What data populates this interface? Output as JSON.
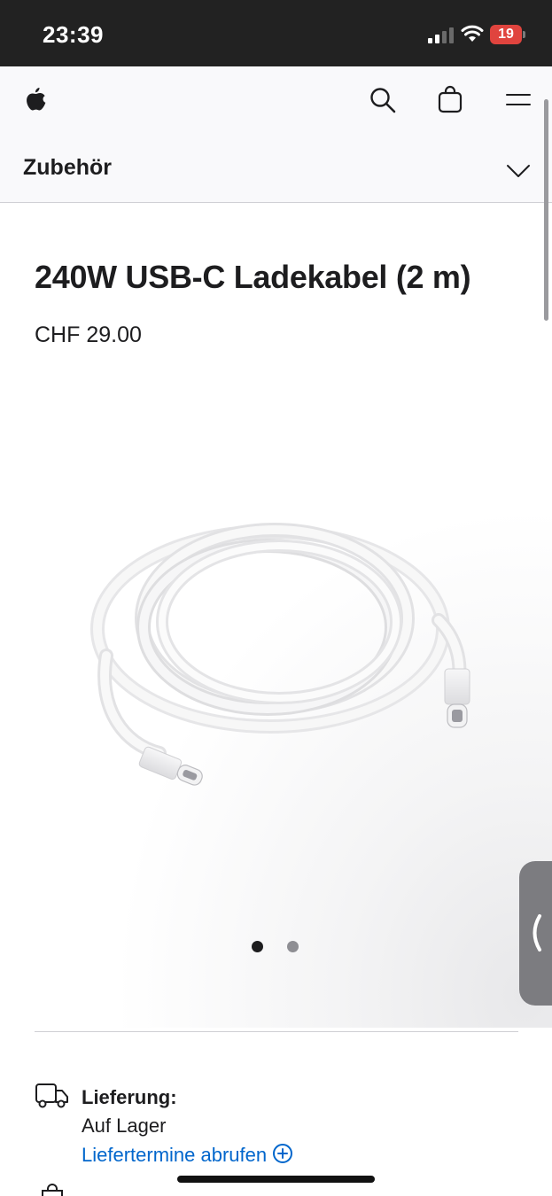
{
  "status_bar": {
    "time": "23:39",
    "battery_level": "19",
    "battery_color": "#e0443e"
  },
  "global_nav": {
    "logo_icon": "apple-logo-icon",
    "search_icon": "search-icon",
    "bag_icon": "shopping-bag-icon",
    "menu_icon": "menu-icon"
  },
  "local_nav": {
    "title": "Zubehör",
    "toggle_icon": "chevron-down-icon"
  },
  "product": {
    "title": "240W USB-C Ladekabel (2 m)",
    "price": "CHF 29.00",
    "image_icon": "usb-c-cable-image"
  },
  "gallery": {
    "pages": 2,
    "current_page": 1
  },
  "side_handle": {
    "icon": "chevron-left-icon"
  },
  "delivery": {
    "icon": "delivery-truck-icon",
    "label": "Lieferung:",
    "status": "Auf Lager",
    "link_text": "Liefertermine abrufen",
    "link_icon": "plus-circle-icon",
    "link_color": "#0066cc"
  },
  "pickup": {
    "icon": "store-bag-icon"
  },
  "colors": {
    "text": "#1d1d1f",
    "status_bar_bg": "#222222",
    "nav_bg": "#f9f9fb"
  }
}
